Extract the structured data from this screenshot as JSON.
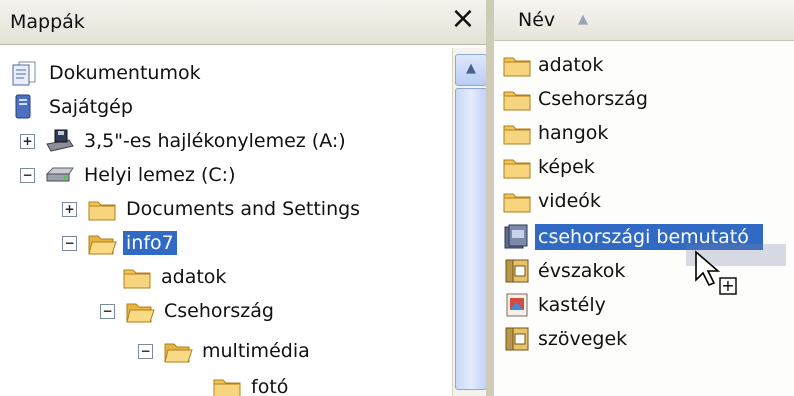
{
  "folders_pane": {
    "title": "Mappák",
    "close_glyph": "×",
    "tree": [
      {
        "label": "Dokumentumok",
        "icon": "documents-icon",
        "toggle": ""
      },
      {
        "label": "Sajátgép",
        "icon": "computer-icon",
        "toggle": ""
      },
      {
        "label": "3,5\"-es hajlékonylemez (A:)",
        "icon": "floppy-drive-icon",
        "toggle": "+"
      },
      {
        "label": "Helyi lemez (C:)",
        "icon": "hard-drive-icon",
        "toggle": "−"
      },
      {
        "label": "Documents and Settings",
        "icon": "folder-icon",
        "toggle": "+"
      },
      {
        "label": "info7",
        "icon": "open-folder-icon",
        "toggle": "−",
        "selected": true
      },
      {
        "label": "adatok",
        "icon": "folder-icon",
        "toggle": ""
      },
      {
        "label": "Csehország",
        "icon": "open-folder-icon",
        "toggle": "−"
      },
      {
        "label": "multimédia",
        "icon": "open-folder-icon",
        "toggle": "−"
      },
      {
        "label": "fotó",
        "icon": "folder-icon",
        "toggle": ""
      }
    ]
  },
  "files_pane": {
    "column_header": "Név",
    "sort": "ascending",
    "items": [
      {
        "label": "adatok",
        "icon": "folder-icon"
      },
      {
        "label": "Csehország",
        "icon": "folder-icon"
      },
      {
        "label": "hangok",
        "icon": "folder-icon"
      },
      {
        "label": "képek",
        "icon": "folder-icon"
      },
      {
        "label": "videók",
        "icon": "folder-icon"
      },
      {
        "label": "csehországi bemutató",
        "icon": "presentation-file-icon",
        "selected": true
      },
      {
        "label": "évszakok",
        "icon": "archive-file-icon"
      },
      {
        "label": "kastély",
        "icon": "image-file-icon"
      },
      {
        "label": "szövegek",
        "icon": "archive-file-icon"
      }
    ]
  },
  "drag": {
    "cursor": "copy-cursor-icon",
    "badge": "+"
  },
  "colors": {
    "selection": "#316ac5",
    "folder": "#f2c45a",
    "scroll": "#c9d8f8"
  }
}
